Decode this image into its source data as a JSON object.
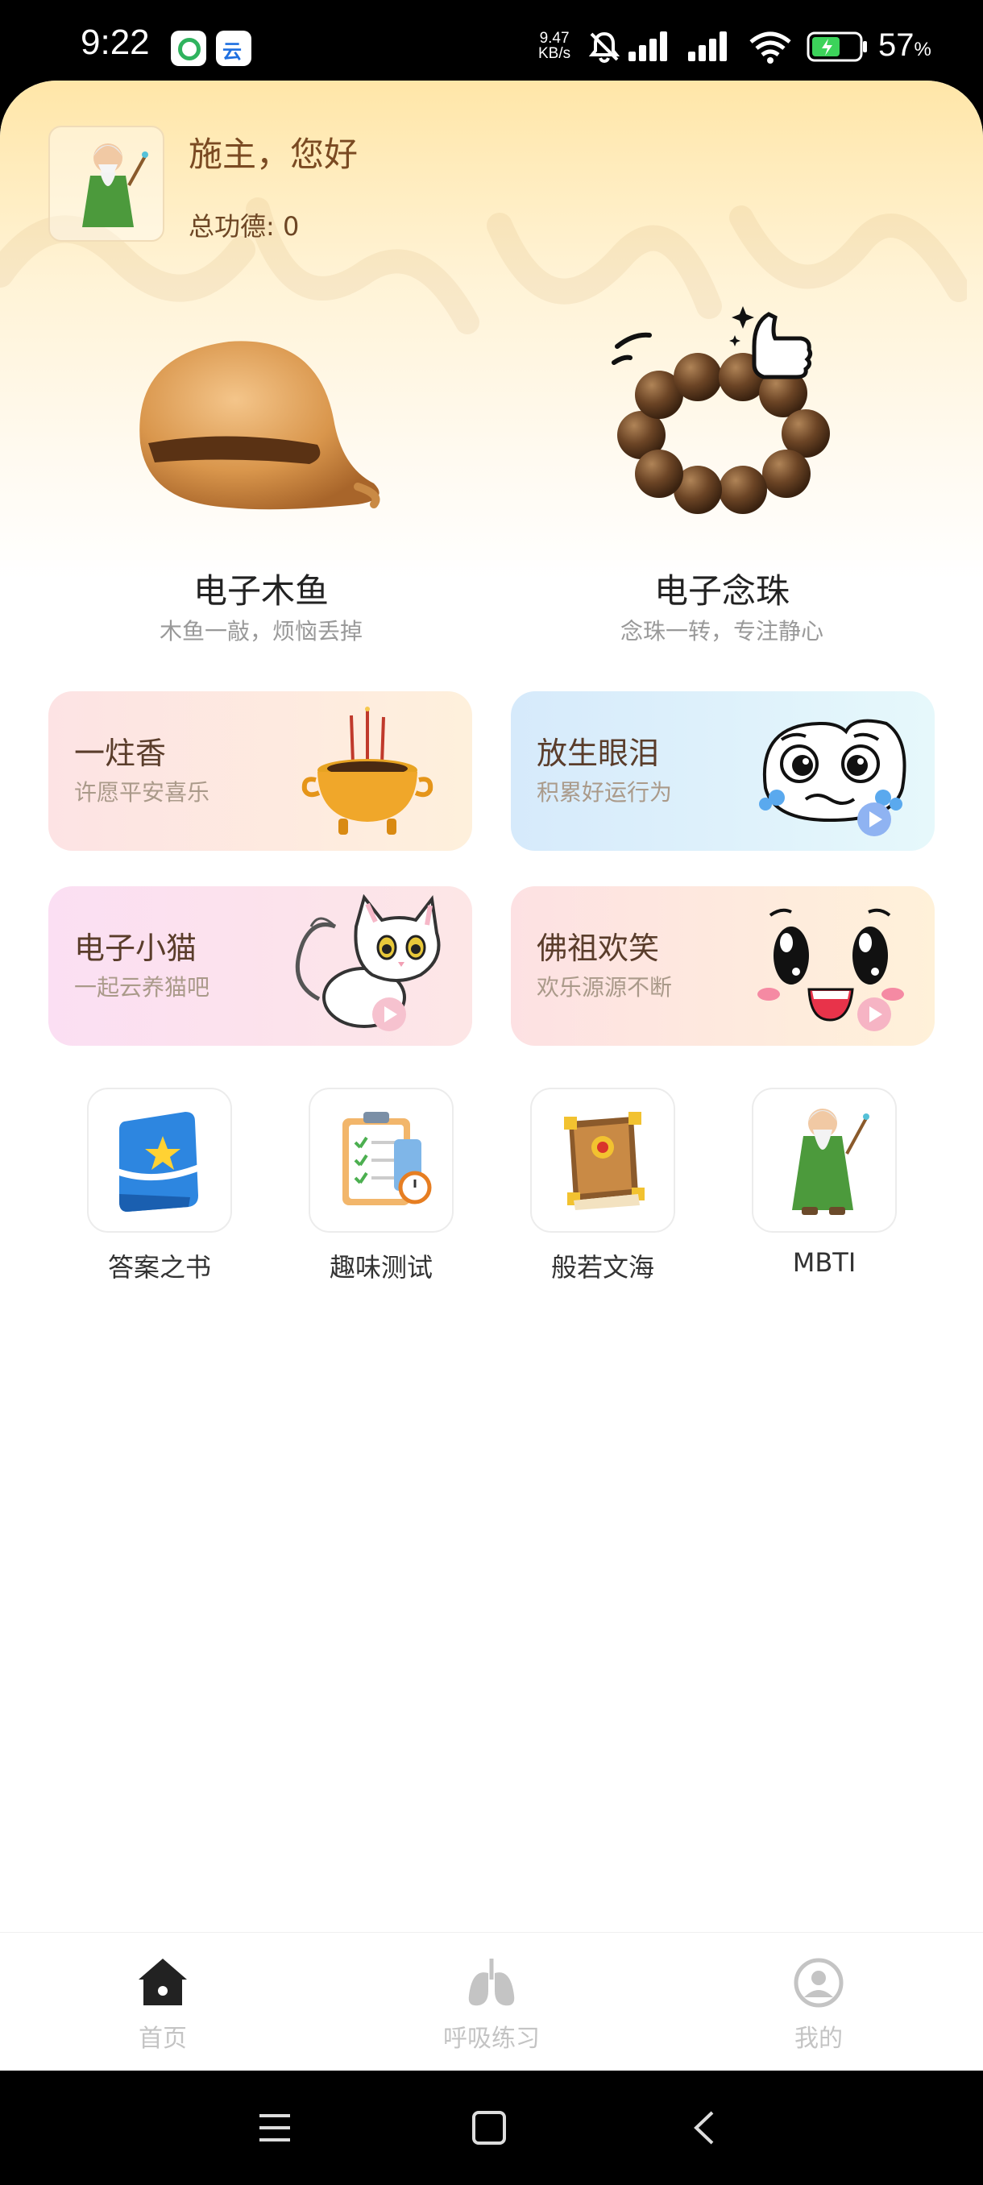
{
  "status_bar": {
    "time": "9:22",
    "net_speed_value": "9.47",
    "net_speed_unit": "KB/s",
    "battery_percent": "57",
    "battery_unit": "%",
    "notif_2_glyph": "云"
  },
  "header": {
    "greeting": "施主，您好",
    "merit": "总功德: 0"
  },
  "tools": {
    "wooden_fish": {
      "title": "电子木鱼",
      "subtitle": "木鱼一敲，烦恼丢掉"
    },
    "prayer_beads": {
      "title": "电子念珠",
      "subtitle": "念珠一转，专注静心"
    }
  },
  "cards": [
    {
      "title": "一炷香",
      "subtitle": "许愿平安喜乐"
    },
    {
      "title": "放生眼泪",
      "subtitle": "积累好运行为"
    },
    {
      "title": "电子小猫",
      "subtitle": "一起云养猫吧"
    },
    {
      "title": "佛祖欢笑",
      "subtitle": "欢乐源源不断"
    }
  ],
  "mini_apps": [
    {
      "label": "答案之书",
      "icon": "book-icon"
    },
    {
      "label": "趣味测试",
      "icon": "clipboard-test-icon"
    },
    {
      "label": "般若文海",
      "icon": "scripture-book-icon"
    },
    {
      "label": "MBTI",
      "icon": "sage-icon"
    }
  ],
  "tabbar": {
    "home": "首页",
    "breathing": "呼吸练习",
    "mine": "我的",
    "active_color": "#222222",
    "inactive_color": "#c4c4c4"
  },
  "colors": {
    "hero_gold": "#ffe6a8",
    "text_brown": "#7a4a22"
  }
}
